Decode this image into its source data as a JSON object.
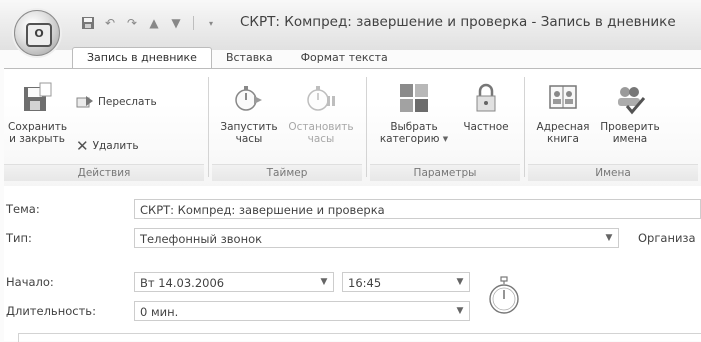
{
  "window": {
    "title": "СКРТ:  Компред: завершение и проверка - Запись в дневнике"
  },
  "tabs": [
    {
      "label": "Запись в дневнике",
      "active": true
    },
    {
      "label": "Вставка",
      "active": false
    },
    {
      "label": "Формат текста",
      "active": false
    }
  ],
  "ribbon": {
    "actions": {
      "label": "Действия",
      "save_close": [
        "Сохранить",
        "и закрыть"
      ],
      "forward": "Переслать",
      "delete": "Удалить"
    },
    "timer": {
      "label": "Таймер",
      "start": [
        "Запустить",
        "часы"
      ],
      "stop": [
        "Остановить",
        "часы"
      ]
    },
    "options": {
      "label": "Параметры",
      "category": [
        "Выбрать",
        "категорию"
      ],
      "private": "Частное"
    },
    "names": {
      "label": "Имена",
      "address_book": [
        "Адресная",
        "книга"
      ],
      "check_names": [
        "Проверить",
        "имена"
      ]
    }
  },
  "form": {
    "subject": {
      "label": "Тема:",
      "value": "СКРТ:  Компред: завершение и проверка"
    },
    "type": {
      "label": "Тип:",
      "value": "Телефонный звонок",
      "company_label": "Организа"
    },
    "start": {
      "label": "Начало:",
      "date": "Вт 14.03.2006",
      "time": "16:45"
    },
    "duration": {
      "label": "Длительность:",
      "value": "0 мин."
    }
  },
  "icons": [
    "office-orb",
    "save-icon",
    "undo-icon",
    "redo-icon",
    "up-icon",
    "down-icon",
    "forward-icon",
    "delete-icon",
    "start-timer-icon",
    "stop-timer-icon",
    "category-icon",
    "lock-icon",
    "address-book-icon",
    "check-names-icon",
    "stopwatch-icon"
  ]
}
